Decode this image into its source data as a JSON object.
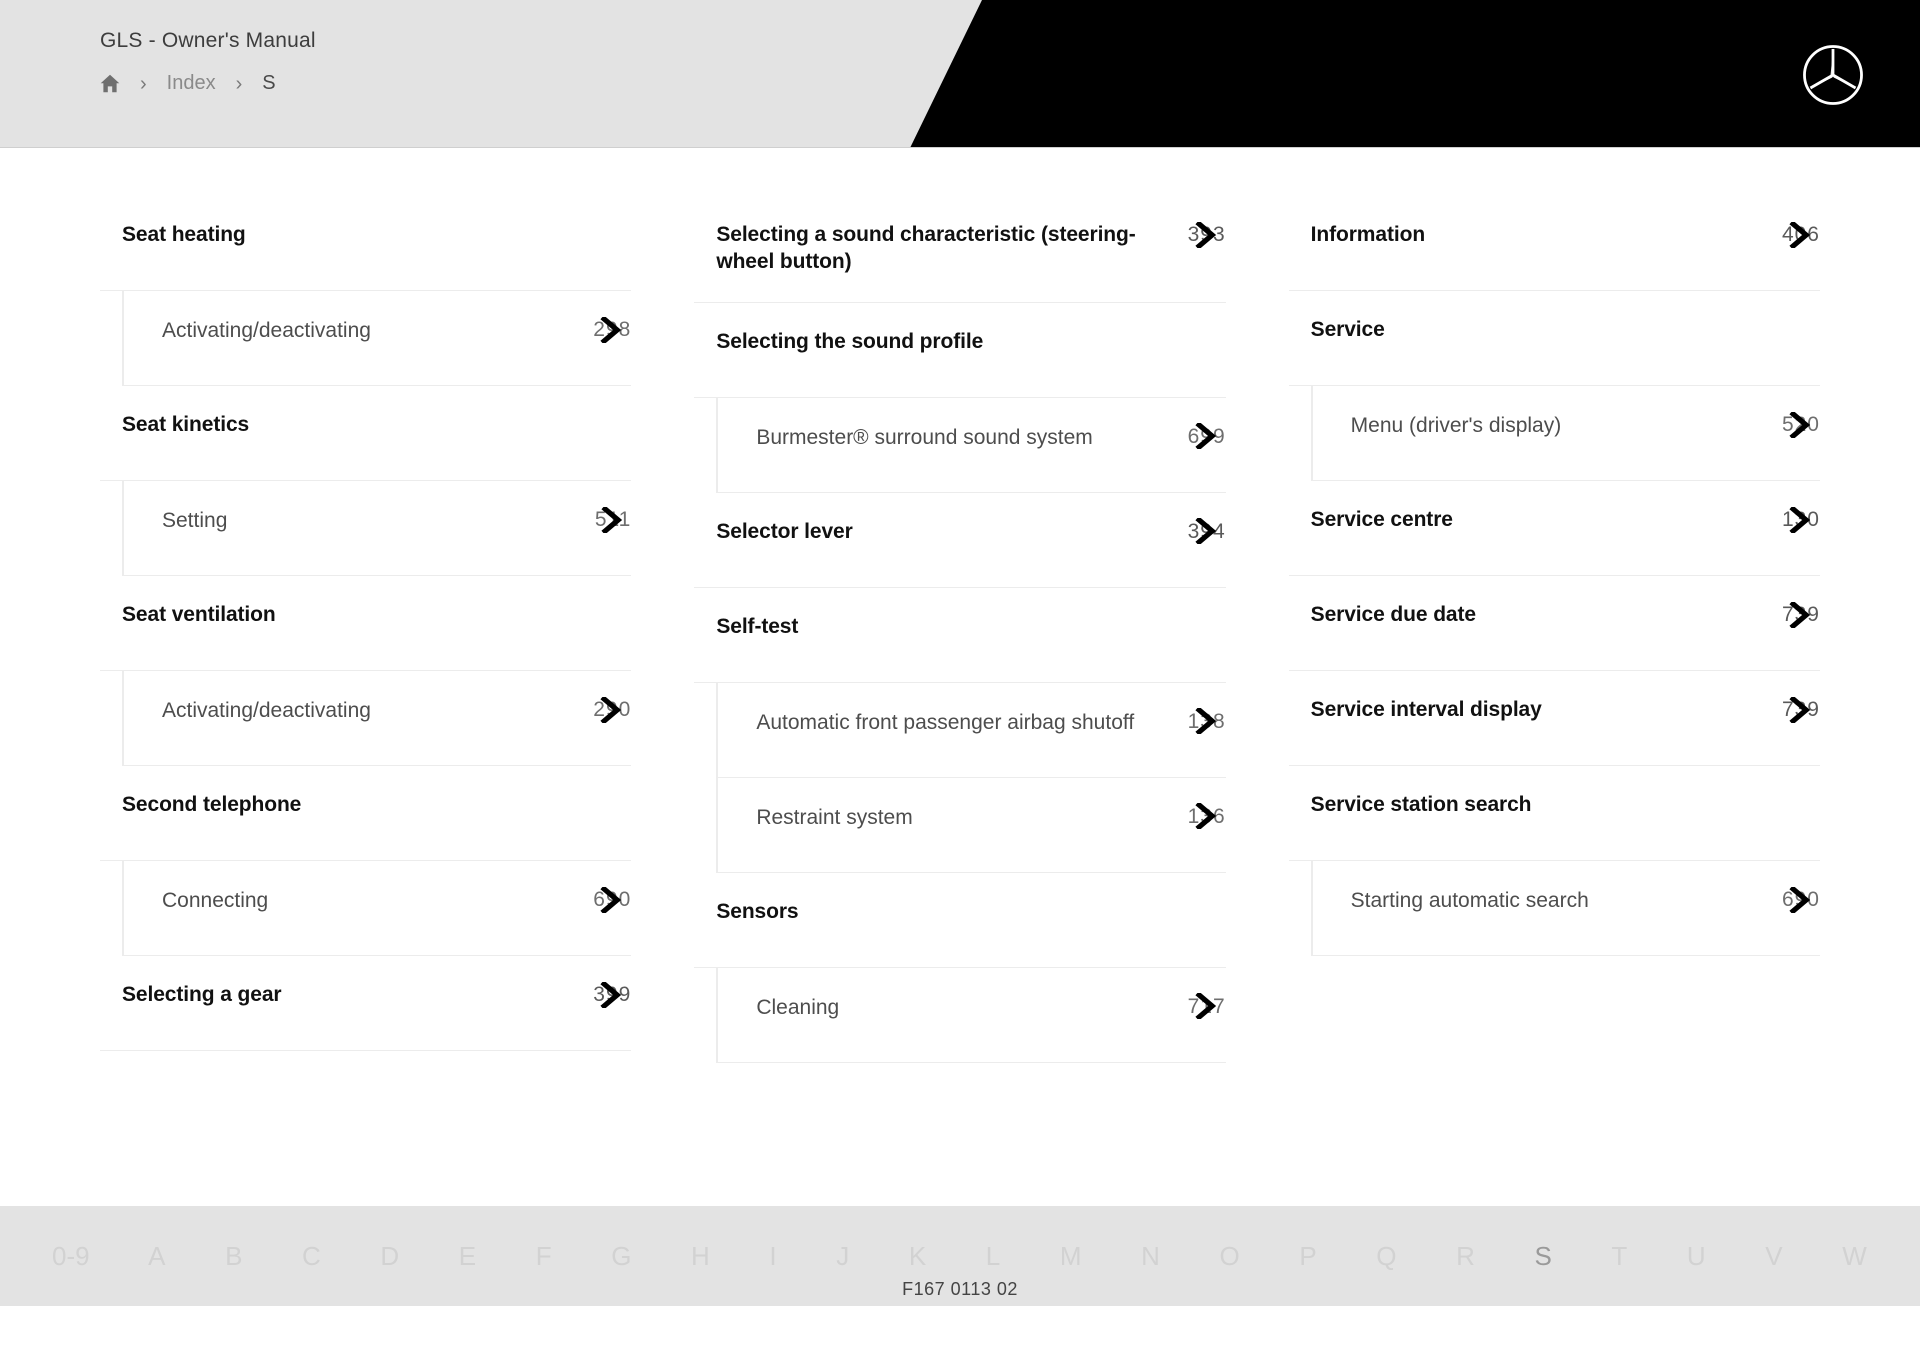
{
  "header": {
    "manual_title": "GLS - Owner's Manual",
    "breadcrumb": {
      "home_icon": "home-icon",
      "separator": "›",
      "items": [
        {
          "label": "Index",
          "current": false
        },
        {
          "label": "S",
          "current": true
        }
      ]
    },
    "brand_logo": "mercedes-benz-star-icon",
    "background_color": "#e3e3e3",
    "banner_color": "#000000"
  },
  "index": {
    "letter": "S",
    "link_icon": "chevron-right-icon",
    "columns": [
      {
        "entries": [
          {
            "label": "Seat heating",
            "page": "",
            "subs": [
              {
                "label": "Activating/deactivating",
                "page": "298"
              }
            ]
          },
          {
            "label": "Seat kinetics",
            "page": "",
            "subs": [
              {
                "label": "Setting",
                "page": "511"
              }
            ]
          },
          {
            "label": "Seat ventilation",
            "page": "",
            "subs": [
              {
                "label": "Activating/deactivating",
                "page": "290"
              }
            ]
          },
          {
            "label": "Second telephone",
            "page": "",
            "subs": [
              {
                "label": "Connecting",
                "page": "690"
              }
            ]
          },
          {
            "label": "Selecting a gear",
            "page": "399",
            "subs": []
          }
        ]
      },
      {
        "entries": [
          {
            "label": "Selecting a sound characteristic (steering-wheel button)",
            "page": "393",
            "subs": []
          },
          {
            "label": "Selecting the sound profile",
            "page": "",
            "subs": [
              {
                "label": "Burmester® surround sound system",
                "page": "699"
              }
            ]
          },
          {
            "label": "Selector lever",
            "page": "394",
            "subs": []
          },
          {
            "label": "Self-test",
            "page": "",
            "subs": [
              {
                "label": "Automatic front passenger airbag shutoff",
                "page": "138"
              },
              {
                "label": "Restraint system",
                "page": "136"
              }
            ]
          },
          {
            "label": "Sensors",
            "page": "",
            "subs": [
              {
                "label": "Cleaning",
                "page": "717"
              }
            ]
          }
        ]
      },
      {
        "entries": [
          {
            "label": "Information",
            "page": "406",
            "bold": false,
            "subs": []
          },
          {
            "label": "Service",
            "page": "",
            "subs": [
              {
                "label": "Menu (driver's display)",
                "page": "520"
              }
            ]
          },
          {
            "label": "Service centre",
            "page": "130",
            "subs": []
          },
          {
            "label": "Service due date",
            "page": "739",
            "subs": []
          },
          {
            "label": "Service interval display",
            "page": "739",
            "subs": []
          },
          {
            "label": "Service station search",
            "page": "",
            "subs": [
              {
                "label": "Starting automatic search",
                "page": "690"
              }
            ]
          }
        ]
      }
    ]
  },
  "alphabet_nav": {
    "active": "S",
    "letters": [
      "0-9",
      "A",
      "B",
      "C",
      "D",
      "E",
      "F",
      "G",
      "H",
      "I",
      "J",
      "K",
      "L",
      "M",
      "N",
      "O",
      "P",
      "Q",
      "R",
      "S",
      "T",
      "U",
      "V",
      "W"
    ]
  },
  "footer": {
    "document_code": "F167 0113 02"
  }
}
